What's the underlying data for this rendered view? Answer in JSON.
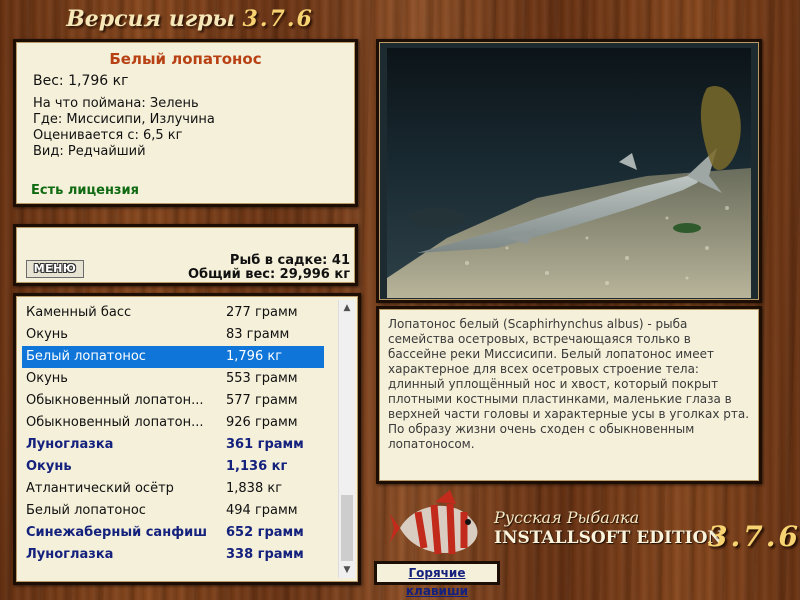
{
  "header": {
    "title": "Версия игры",
    "version": "3.7.6"
  },
  "info": {
    "fish_name": "Белый лопатонос",
    "weight": "Вес: 1,796 кг",
    "details": [
      "На что поймана: Зелень",
      "Где: Миссисипи, Излучина",
      "Оценивается с: 6,5 кг",
      "Вид: Редчайший"
    ],
    "license": "Есть лицензия"
  },
  "keep": {
    "menu_label": "МЕНЮ",
    "fish_count": "Рыб в садке: 41",
    "total_weight": "Общий вес: 29,996 кг"
  },
  "catch_list": [
    {
      "name": "Каменный басс",
      "weight": "277 грамм",
      "style": ""
    },
    {
      "name": "Окунь",
      "weight": "83 грамм",
      "style": ""
    },
    {
      "name": "Белый лопатонос",
      "weight": "1,796 кг",
      "style": "sel"
    },
    {
      "name": "Окунь",
      "weight": "553 грамм",
      "style": ""
    },
    {
      "name": "Обыкновенный лопатон...",
      "weight": "577 грамм",
      "style": ""
    },
    {
      "name": "Обыкновенный лопатон...",
      "weight": "926 грамм",
      "style": ""
    },
    {
      "name": "Луноглазка",
      "weight": "361 грамм",
      "style": "bold"
    },
    {
      "name": "Окунь",
      "weight": "1,136 кг",
      "style": "bold"
    },
    {
      "name": "Атлантический осётр",
      "weight": "1,838 кг",
      "style": ""
    },
    {
      "name": "Белый лопатонос",
      "weight": "494 грамм",
      "style": ""
    },
    {
      "name": "Синежаберный санфиш",
      "weight": "652 грамм",
      "style": "bold"
    },
    {
      "name": "Луноглазка",
      "weight": "338 грамм",
      "style": "bold"
    }
  ],
  "description": "Лопатонос белый (Scaphirhynchus albus) - рыба семейства осетровых, встречающаяся только в бассейне реки Миссисипи. Белый лопатонос имеет характерное для всех осетровых строение тела: длинный уплощённый нос и хвост, который покрыт плотными костными пластинками, маленькие глаза в верхней части головы и характерные усы в уголках рта. По образу жизни очень сходен с обыкновенным лопатоносом.",
  "logo": {
    "line1": "Русская Рыбалка",
    "line2": "INSTALLSOFT EDITION",
    "version": "3.7.6"
  },
  "hotkeys_label": "Горячие клавиши"
}
